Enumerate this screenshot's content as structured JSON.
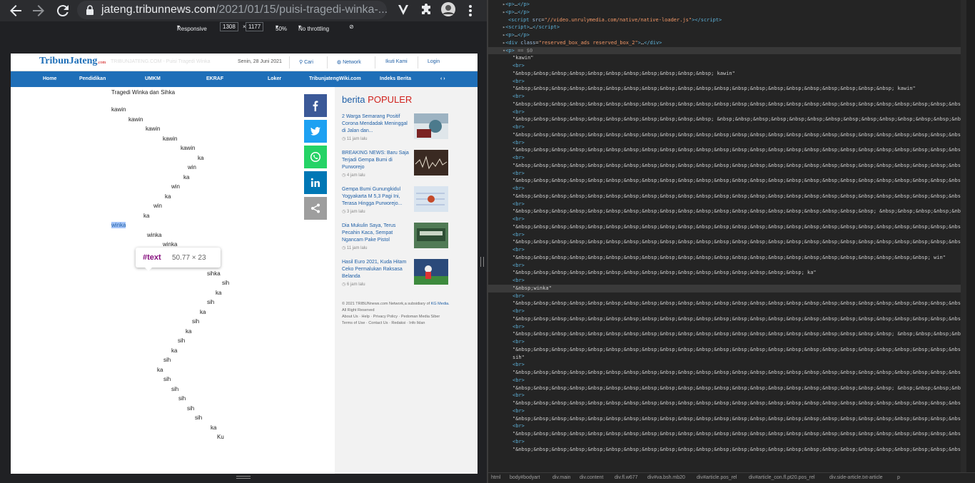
{
  "browser": {
    "url_domain": "jateng.tribunnews.com",
    "url_path": "/2021/01/15/puisi-tragedi-winka-...",
    "back_icon": "arrow-left-icon",
    "forward_icon": "arrow-right-icon",
    "reload_icon": "reload-icon",
    "menu_icon": "vertical-dots-icon"
  },
  "device_toolbar": {
    "mode": "Responsive",
    "width": "1308",
    "times": "×",
    "height": "1177",
    "zoom": "50%",
    "throttle": "No throttling"
  },
  "site": {
    "logo": "TribunJateng",
    "logo_sub": ".com",
    "ghost_text": "TRIBUNJATENG.COM - Puisi Tragedi Winka",
    "date": "Senin, 28 Juni 2021",
    "search": "Cari",
    "network": "Network",
    "follow": "Ikuti Kami",
    "login": "Login",
    "menu": [
      "Home",
      "Pendidikan",
      "UMKM",
      "EKRAF",
      "Loker",
      "TribunjatengWiki.com",
      "Indeks Berita"
    ],
    "menu_arrows": "‹ ›"
  },
  "poem": {
    "title": "Tragedi Winka dan Sihka",
    "lines": [
      "kawin",
      "kawin",
      "kawin",
      "kawin",
      "kawin",
      "ka",
      "win",
      "ka",
      "win",
      "ka",
      "win",
      "ka",
      "winka",
      "winka",
      "winka",
      "sihka",
      "sihka",
      "sihka",
      "sih",
      "ka",
      "sih",
      "ka",
      "sih",
      "ka",
      "sih",
      "ka",
      "sih",
      "ka",
      "sih",
      "sih",
      "sih",
      "sih",
      "sih",
      "ka",
      "Ku"
    ]
  },
  "inspect_tooltip": {
    "node": "#text",
    "size": "50.77 × 23"
  },
  "popular": {
    "title_a": "berita",
    "title_b": "POPULER",
    "items": [
      {
        "title": "2 Warga Semarang Positif Corona Mendadak Meninggal di Jalan dan...",
        "time": "11 jam lalu"
      },
      {
        "title": "BREAKING NEWS: Baru Saja Terjadi Gempa Bumi di Purworejo",
        "time": "4 jam lalu"
      },
      {
        "title": "Gempa Bumi Gunungkidul Yogyakarta M 5,3 Pagi Ini, Terasa Hingga Purworejo...",
        "time": "3 jam lalu"
      },
      {
        "title": "Dia Mukulin Saya, Terus Pecahin Kaca, Sempat Ngancam Pake Pistol",
        "time": "11 jam lalu"
      },
      {
        "title": "Hasil Euro 2021, Kuda Hitam Ceko Permalukan Raksasa Belanda",
        "time": "6 jam lalu"
      }
    ],
    "footer_line1": "© 2021 TRIBUNnews.com Network,a subsidiary of",
    "footer_kg": "KG Media.",
    "footer_line2": "All Right Reserved",
    "footer_links": [
      "About Us",
      "Help",
      "Privacy Policy",
      "Pedoman Media Siber",
      "Terms of Use",
      "Contact Us",
      "Redaksi",
      "Info Iklan"
    ]
  },
  "devtools": {
    "dom_lines": [
      {
        "indent": 20,
        "html": "<span class='gray'>▸</span><span class='tag'>&lt;p&gt;</span>…<span class='tag'>&lt;/p&gt;</span>"
      },
      {
        "indent": 20,
        "html": "<span class='gray'>▸</span><span class='tag'>&lt;p&gt;</span>…<span class='tag'>&lt;/p&gt;</span>"
      },
      {
        "indent": 28,
        "html": "<span class='tag'>&lt;script </span><span class='attr'>src</span>=<span class='val'>\"//video.unrulymedia.com/native/native-loader.js\"</span><span class='tag'>&gt;&lt;/script&gt;</span>"
      },
      {
        "indent": 20,
        "html": "<span class='gray'>▸</span><span class='tag'>&lt;script&gt;</span>…<span class='tag'>&lt;/script&gt;</span>"
      },
      {
        "indent": 20,
        "html": "<span class='gray'>▸</span><span class='tag'>&lt;p&gt;</span>…<span class='tag'>&lt;/p&gt;</span>"
      },
      {
        "indent": 20,
        "html": "<span class='gray'>▸</span><span class='tag'>&lt;div </span><span class='attr'>class</span>=<span class='val'>\"reserved_box_ads reserved_box_2\"</span><span class='tag'>&gt;</span>…<span class='tag'>&lt;/div&gt;</span>"
      },
      {
        "indent": 20,
        "html": "<span class='gray'>▾</span><span class='tag'>&lt;p&gt;</span> <span class='gray'>== $0</span>",
        "cls": "hl"
      },
      {
        "indent": 34,
        "html": "<span class='txt'>\"kawin\"</span>"
      },
      {
        "indent": 34,
        "html": "<span class='tag'>&lt;br&gt;</span>"
      },
      {
        "indent": 34,
        "html": "<span class='txt'>\"&amp;nbsp;&amp;nbsp;&amp;nbsp;&amp;nbsp;&amp;nbsp;&amp;nbsp;&amp;nbsp;&amp;nbsp;&amp;nbsp;&amp;nbsp;&amp;nbsp; kawin\"</span>"
      },
      {
        "indent": 34,
        "html": "<span class='tag'>&lt;br&gt;</span>"
      },
      {
        "indent": 34,
        "html": "<span class='txt'>\"&amp;nbsp;&amp;nbsp;&amp;nbsp;&amp;nbsp;&amp;nbsp;&amp;nbsp;&amp;nbsp;&amp;nbsp;&amp;nbsp;&amp;nbsp;&amp;nbsp;&amp;nbsp;&amp;nbsp;&amp;nbsp;&amp;nbsp;&amp;nbsp;&amp;nbsp;&amp;nbsp;&amp;nbsp;&amp;nbsp;&amp;nbsp; kawin\"</span>"
      },
      {
        "indent": 34,
        "html": "<span class='tag'>&lt;br&gt;</span>"
      },
      {
        "indent": 34,
        "html": "<span class='txt'>\"&amp;nbsp;&amp;nbsp;&amp;nbsp;&amp;nbsp;&amp;nbsp;&amp;nbsp;&amp;nbsp;&amp;nbsp;&amp;nbsp;&amp;nbsp;&amp;nbsp;&amp;nbsp;&amp;nbsp;&amp;nbsp;&amp;nbsp;&amp;nbsp;&amp;nbsp;&amp;nbsp;&amp;nbsp;&amp;nbsp;&amp;nbsp;&amp;nbsp;&amp;nbsp;&amp;nbsp;&amp;nbsp;&amp;nbsp;&amp;nbsp;&amp;nbsp;&amp;nbsp;&amp;nbsp;&amp;nbsp;&amp;nbsp;&amp;nbsp;&amp;nbsp;&amp;nbsp;\"</span>"
      },
      {
        "indent": 34,
        "html": "<span class='tag'>&lt;br&gt;</span>"
      },
      {
        "indent": 34,
        "html": "<span class='txt'>\"&amp;nbsp;&amp;nbsp;&amp;nbsp;&amp;nbsp;&amp;nbsp;&amp;nbsp;&amp;nbsp;&amp;nbsp;&amp;nbsp;&amp;nbsp;&amp;nbsp; &amp;nbsp;&amp;nbsp;&amp;nbsp;&amp;nbsp;&amp;nbsp;&amp;nbsp;&amp;nbsp;&amp;nbsp;&amp;nbsp;&amp;nbsp;&amp;nbsp;&amp;nbsp;&amp;nbsp;&amp;nbsp;&amp;nbsp;&amp;nbsp;&amp;nbsp;&amp;nbsp;&amp;nbsp;&amp;nbsp;&amp;nbsp;&amp;nbsp;&amp;nbsp;\"</span>"
      },
      {
        "indent": 34,
        "html": "<span class='tag'>&lt;br&gt;</span>"
      },
      {
        "indent": 34,
        "html": "<span class='txt'>\"&amp;nbsp;&amp;nbsp;&amp;nbsp;&amp;nbsp;&amp;nbsp;&amp;nbsp;&amp;nbsp;&amp;nbsp;&amp;nbsp;&amp;nbsp;&amp;nbsp;&amp;nbsp;&amp;nbsp;&amp;nbsp;&amp;nbsp;&amp;nbsp;&amp;nbsp;&amp;nbsp;&amp;nbsp;&amp;nbsp;&amp;nbsp;&amp;nbsp;&amp;nbsp;&amp;nbsp;&amp;nbsp;&amp;nbsp;&amp;nbsp;&amp;nbsp;&amp;nbsp;&amp;nbsp;&amp;nbsp;&amp;nbsp;&amp;nbsp;&amp;nbsp;&amp;nbsp;\"</span>"
      },
      {
        "indent": 34,
        "html": "<span class='tag'>&lt;br&gt;</span>"
      },
      {
        "indent": 34,
        "html": "<span class='txt'>\"&amp;nbsp;&amp;nbsp;&amp;nbsp;&amp;nbsp;&amp;nbsp;&amp;nbsp;&amp;nbsp;&amp;nbsp;&amp;nbsp;&amp;nbsp;&amp;nbsp;&amp;nbsp;&amp;nbsp;&amp;nbsp;&amp;nbsp;&amp;nbsp;&amp;nbsp;&amp;nbsp;&amp;nbsp;&amp;nbsp;&amp;nbsp;&amp;nbsp;&amp;nbsp;&amp;nbsp;&amp;nbsp;&amp;nbsp;&amp;nbsp;&amp;nbsp;&amp;nbsp;&amp;nbsp;&amp;nbsp;&amp;nbsp;&amp;nbsp;&amp;nbsp;&amp;nbsp;\"</span>"
      },
      {
        "indent": 34,
        "html": "<span class='tag'>&lt;br&gt;</span>"
      },
      {
        "indent": 34,
        "html": "<span class='txt'>\"&amp;nbsp;&amp;nbsp;&amp;nbsp;&amp;nbsp;&amp;nbsp;&amp;nbsp;&amp;nbsp;&amp;nbsp;&amp;nbsp;&amp;nbsp;&amp;nbsp;&amp;nbsp;&amp;nbsp;&amp;nbsp;&amp;nbsp;&amp;nbsp;&amp;nbsp;&amp;nbsp;&amp;nbsp;&amp;nbsp;&amp;nbsp;&amp;nbsp;&amp;nbsp;&amp;nbsp;&amp;nbsp;&amp;nbsp;&amp;nbsp;&amp;nbsp;&amp;nbsp;&amp;nbsp;&amp;nbsp;&amp;nbsp;&amp;nbsp;&amp;nbsp;&amp;nbsp;\"</span>"
      },
      {
        "indent": 34,
        "html": "<span class='tag'>&lt;br&gt;</span>"
      },
      {
        "indent": 34,
        "html": "<span class='txt'>\"&amp;nbsp;&amp;nbsp;&amp;nbsp;&amp;nbsp;&amp;nbsp;&amp;nbsp;&amp;nbsp;&amp;nbsp;&amp;nbsp;&amp;nbsp;&amp;nbsp;&amp;nbsp;&amp;nbsp;&amp;nbsp;&amp;nbsp;&amp;nbsp;&amp;nbsp;&amp;nbsp;&amp;nbsp;&amp;nbsp;&amp;nbsp;&amp;nbsp;&amp;nbsp;&amp;nbsp;&amp;nbsp;&amp;nbsp;&amp;nbsp;&amp;nbsp;&amp;nbsp;&amp;nbsp;&amp;nbsp;&amp;nbsp;&amp;nbsp;&amp;nbsp;&amp;nbsp;\"</span>"
      },
      {
        "indent": 34,
        "html": "<span class='tag'>&lt;br&gt;</span>"
      },
      {
        "indent": 34,
        "html": "<span class='txt'>\"&amp;nbsp;&amp;nbsp;&amp;nbsp;&amp;nbsp;&amp;nbsp;&amp;nbsp;&amp;nbsp;&amp;nbsp;&amp;nbsp;&amp;nbsp;&amp;nbsp;&amp;nbsp;&amp;nbsp;&amp;nbsp;&amp;nbsp;&amp;nbsp;&amp;nbsp;&amp;nbsp;&amp;nbsp;&amp;nbsp;&amp;nbsp;&amp;nbsp;&amp;nbsp;&amp;nbsp;&amp;nbsp;&amp;nbsp;&amp;nbsp;&amp;nbsp;&amp;nbsp;&amp;nbsp;&amp;nbsp;&amp;nbsp;&amp;nbsp;&amp;nbsp;&amp;nbsp;\"</span>"
      },
      {
        "indent": 34,
        "html": "<span class='tag'>&lt;br&gt;</span>"
      },
      {
        "indent": 34,
        "html": "<span class='txt'>\"&amp;nbsp;&amp;nbsp;&amp;nbsp;&amp;nbsp;&amp;nbsp;&amp;nbsp;&amp;nbsp;&amp;nbsp;&amp;nbsp;&amp;nbsp;&amp;nbsp;&amp;nbsp;&amp;nbsp;&amp;nbsp;&amp;nbsp;&amp;nbsp;&amp;nbsp;&amp;nbsp;&amp;nbsp;&amp;nbsp; &amp;nbsp;&amp;nbsp;&amp;nbsp;&amp;nbsp;&amp;nbsp;&amp;nbsp;&amp;nbsp;&amp;nbsp;&amp;nbsp;&amp;nbsp;&amp;nbsp;&amp;nbsp;&amp;nbsp;&amp;nbsp;\"</span>"
      },
      {
        "indent": 34,
        "html": "<span class='tag'>&lt;br&gt;</span>"
      },
      {
        "indent": 34,
        "html": "<span class='txt'>\"&amp;nbsp;&amp;nbsp;&amp;nbsp;&amp;nbsp;&amp;nbsp;&amp;nbsp;&amp;nbsp;&amp;nbsp;&amp;nbsp;&amp;nbsp;&amp;nbsp;&amp;nbsp;&amp;nbsp;&amp;nbsp;&amp;nbsp;&amp;nbsp;&amp;nbsp;&amp;nbsp;&amp;nbsp;&amp;nbsp;&amp;nbsp;&amp;nbsp;&amp;nbsp;&amp;nbsp;&amp;nbsp;&amp;nbsp;&amp;nbsp;&amp;nbsp;&amp;nbsp;&amp;nbsp;&amp;nbsp;&amp;nbsp;&amp;nbsp;&amp;nbsp;&amp;nbsp;\"</span>"
      },
      {
        "indent": 34,
        "html": "<span class='tag'>&lt;br&gt;</span>"
      },
      {
        "indent": 34,
        "html": "<span class='txt'>\"&amp;nbsp;&amp;nbsp;&amp;nbsp;&amp;nbsp;&amp;nbsp;&amp;nbsp;&amp;nbsp;&amp;nbsp;&amp;nbsp;&amp;nbsp;&amp;nbsp;&amp;nbsp;&amp;nbsp;&amp;nbsp;&amp;nbsp;&amp;nbsp;&amp;nbsp;&amp;nbsp;&amp;nbsp;&amp;nbsp;&amp;nbsp;&amp;nbsp;&amp;nbsp;&amp;nbsp;&amp;nbsp;&amp;nbsp; ka\"</span>"
      },
      {
        "indent": 34,
        "html": "<span class='tag'>&lt;br&gt;</span>"
      },
      {
        "indent": 34,
        "html": "<span class='txt'>\"&amp;nbsp;&amp;nbsp;&amp;nbsp;&amp;nbsp;&amp;nbsp;&amp;nbsp;&amp;nbsp;&amp;nbsp;&amp;nbsp;&amp;nbsp;&amp;nbsp;&amp;nbsp;&amp;nbsp;&amp;nbsp;&amp;nbsp;&amp;nbsp;&amp;nbsp;&amp;nbsp;&amp;nbsp;&amp;nbsp;&amp;nbsp;&amp;nbsp;&amp;nbsp; win\"</span>"
      },
      {
        "indent": 34,
        "html": "<span class='tag'>&lt;br&gt;</span>"
      },
      {
        "indent": 34,
        "html": "<span class='txt'>\"&amp;nbsp;&amp;nbsp;&amp;nbsp;&amp;nbsp;&amp;nbsp;&amp;nbsp;&amp;nbsp;&amp;nbsp;&amp;nbsp;&amp;nbsp;&amp;nbsp;&amp;nbsp;&amp;nbsp;&amp;nbsp;&amp;nbsp;&amp;nbsp; ka\"</span>"
      },
      {
        "indent": 34,
        "html": "<span class='tag'>&lt;br&gt;</span>"
      },
      {
        "indent": 34,
        "html": "<span class='txt'>\"&amp;nbsp;winka\"</span>",
        "cls": "sel2"
      },
      {
        "indent": 34,
        "html": "<span class='tag'>&lt;br&gt;</span>"
      },
      {
        "indent": 34,
        "html": "<span class='txt'>\"&amp;nbsp;&amp;nbsp;&amp;nbsp;&amp;nbsp;&amp;nbsp;&amp;nbsp;&amp;nbsp;&amp;nbsp;&amp;nbsp;&amp;nbsp;&amp;nbsp;&amp;nbsp;&amp;nbsp;&amp;nbsp;&amp;nbsp;&amp;nbsp;&amp;nbsp;&amp;nbsp;&amp;nbsp;&amp;nbsp;&amp;nbsp;&amp;nbsp;&amp;nbsp;&amp;nbsp;&amp;nbsp;&amp;nbsp;&amp;nbsp; winka\"</span>"
      },
      {
        "indent": 34,
        "html": "<span class='tag'>&lt;br&gt;</span>"
      },
      {
        "indent": 34,
        "html": "<span class='txt'>\"&amp;nbsp;&amp;nbsp;&amp;nbsp;&amp;nbsp;&amp;nbsp;&amp;nbsp;&amp;nbsp;&amp;nbsp;&amp;nbsp;&amp;nbsp;&amp;nbsp;&amp;nbsp;&amp;nbsp;&amp;nbsp;&amp;nbsp;&amp;nbsp;&amp;nbsp;&amp;nbsp;&amp;nbsp;&amp;nbsp;&amp;nbsp;&amp;nbsp;&amp;nbsp;&amp;nbsp;&amp;nbsp;&amp;nbsp;&amp;nbsp;&amp;nbsp;&amp;nbsp;&amp;nbsp;&amp;nbsp;&amp;nbsp;&amp;nbsp;&amp;nbsp;&amp;nbsp;\"</span>"
      },
      {
        "indent": 34,
        "html": "<span class='tag'>&lt;br&gt;</span>"
      },
      {
        "indent": 34,
        "html": "<span class='txt'>\"&amp;nbsp;&amp;nbsp;&amp;nbsp;&amp;nbsp;&amp;nbsp;&amp;nbsp;&amp;nbsp;&amp;nbsp;&amp;nbsp;&amp;nbsp;&amp;nbsp;&amp;nbsp;&amp;nbsp;&amp;nbsp;&amp;nbsp;&amp;nbsp;&amp;nbsp;&amp;nbsp;&amp;nbsp;&amp;nbsp;&amp;nbsp; &amp;nbsp;&amp;nbsp;&amp;nbsp;&amp;nbsp;&amp;nbsp;&amp;nbsp;&amp;nbsp;&amp;nbsp;&amp;nbsp;&amp;nbsp;&amp;nbsp;&amp;nbsp;&amp;nbsp;\"</span>"
      },
      {
        "indent": 34,
        "html": "<span class='tag'>&lt;br&gt;</span>"
      },
      {
        "indent": 34,
        "html": "<span class='txt'>\"&amp;nbsp;&amp;nbsp;&amp;nbsp;&amp;nbsp;&amp;nbsp;&amp;nbsp;&amp;nbsp;&amp;nbsp;&amp;nbsp;&amp;nbsp;&amp;nbsp;&amp;nbsp;&amp;nbsp;&amp;nbsp;&amp;nbsp;&amp;nbsp;&amp;nbsp;&amp;nbsp;&amp;nbsp;&amp;nbsp;&amp;nbsp;&amp;nbsp;&amp;nbsp;&amp;nbsp;&amp;nbsp;&amp;nbsp;&amp;nbsp;&amp;nbsp;&amp;nbsp;&amp;nbsp;&amp;nbsp;&amp;nbsp;&amp;nbsp;&amp;nbsp;&amp;nbsp;\"</span>"
      },
      {
        "indent": 34,
        "html": "<span class='txt'>sih\"</span>"
      },
      {
        "indent": 34,
        "html": "<span class='tag'>&lt;br&gt;</span>"
      },
      {
        "indent": 34,
        "html": "<span class='txt'>\"&amp;nbsp;&amp;nbsp;&amp;nbsp;&amp;nbsp;&amp;nbsp;&amp;nbsp;&amp;nbsp;&amp;nbsp;&amp;nbsp;&amp;nbsp;&amp;nbsp;&amp;nbsp;&amp;nbsp;&amp;nbsp;&amp;nbsp;&amp;nbsp;&amp;nbsp;&amp;nbsp;&amp;nbsp;&amp;nbsp;&amp;nbsp;&amp;nbsp;&amp;nbsp;&amp;nbsp;&amp;nbsp;&amp;nbsp;&amp;nbsp;&amp;nbsp;&amp;nbsp;&amp;nbsp;&amp;nbsp;&amp;nbsp;&amp;nbsp;&amp;nbsp;&amp;nbsp;\"</span>"
      },
      {
        "indent": 34,
        "html": "<span class='tag'>&lt;br&gt;</span>"
      },
      {
        "indent": 34,
        "html": "<span class='txt'>\"&amp;nbsp;&amp;nbsp;&amp;nbsp;&amp;nbsp;&amp;nbsp;&amp;nbsp;&amp;nbsp;&amp;nbsp;&amp;nbsp;&amp;nbsp;&amp;nbsp;&amp;nbsp;&amp;nbsp;&amp;nbsp;&amp;nbsp;&amp;nbsp;&amp;nbsp;&amp;nbsp;&amp;nbsp;&amp;nbsp;&amp;nbsp; &amp;nbsp;&amp;nbsp;&amp;nbsp;&amp;nbsp;&amp;nbsp;&amp;nbsp;&amp;nbsp;&amp;nbsp;&amp;nbsp;&amp;nbsp;&amp;nbsp;&amp;nbsp;&amp;nbsp;\"</span>"
      },
      {
        "indent": 34,
        "html": "<span class='tag'>&lt;br&gt;</span>"
      },
      {
        "indent": 34,
        "html": "<span class='txt'>\"&amp;nbsp;&amp;nbsp;&amp;nbsp;&amp;nbsp;&amp;nbsp;&amp;nbsp;&amp;nbsp;&amp;nbsp;&amp;nbsp;&amp;nbsp;&amp;nbsp;&amp;nbsp;&amp;nbsp;&amp;nbsp;&amp;nbsp;&amp;nbsp;&amp;nbsp;&amp;nbsp;&amp;nbsp;&amp;nbsp;&amp;nbsp;&amp;nbsp;&amp;nbsp;&amp;nbsp;&amp;nbsp;&amp;nbsp;&amp;nbsp;&amp;nbsp;&amp;nbsp;&amp;nbsp;&amp;nbsp;&amp;nbsp;&amp;nbsp;&amp;nbsp;&amp;nbsp;\"</span>"
      },
      {
        "indent": 34,
        "html": "<span class='tag'>&lt;br&gt;</span>"
      },
      {
        "indent": 34,
        "html": "<span class='txt'>\"&amp;nbsp;&amp;nbsp;&amp;nbsp;&amp;nbsp;&amp;nbsp;&amp;nbsp;&amp;nbsp;&amp;nbsp;&amp;nbsp;&amp;nbsp;&amp;nbsp;&amp;nbsp;&amp;nbsp;&amp;nbsp;&amp;nbsp;&amp;nbsp;&amp;nbsp;&amp;nbsp;&amp;nbsp;&amp;nbsp;&amp;nbsp;&amp;nbsp;&amp;nbsp;&amp;nbsp;&amp;nbsp;&amp;nbsp;&amp;nbsp;&amp;nbsp;&amp;nbsp;&amp;nbsp;&amp;nbsp;&amp;nbsp;&amp;nbsp;&amp;nbsp;&amp;nbsp;\"</span>"
      },
      {
        "indent": 34,
        "html": "<span class='tag'>&lt;br&gt;</span>"
      },
      {
        "indent": 34,
        "html": "<span class='txt'>\"&amp;nbsp;&amp;nbsp;&amp;nbsp;&amp;nbsp;&amp;nbsp;&amp;nbsp;&amp;nbsp;&amp;nbsp;&amp;nbsp;&amp;nbsp;&amp;nbsp;&amp;nbsp;&amp;nbsp;&amp;nbsp;&amp;nbsp;&amp;nbsp;&amp;nbsp;&amp;nbsp;&amp;nbsp;&amp;nbsp;&amp;nbsp;&amp;nbsp;&amp;nbsp;&amp;nbsp;&amp;nbsp;&amp;nbsp;&amp;nbsp;&amp;nbsp;&amp;nbsp;&amp;nbsp;&amp;nbsp;&amp;nbsp;&amp;nbsp;&amp;nbsp;&amp;nbsp;\"</span>"
      },
      {
        "indent": 34,
        "html": "<span class='tag'>&lt;br&gt;</span>"
      },
      {
        "indent": 34,
        "html": "<span class='txt'>\"&amp;nbsp;&amp;nbsp;&amp;nbsp;&amp;nbsp;&amp;nbsp;&amp;nbsp;&amp;nbsp;&amp;nbsp;&amp;nbsp;&amp;nbsp;&amp;nbsp;&amp;nbsp;&amp;nbsp;&amp;nbsp;&amp;nbsp;&amp;nbsp;&amp;nbsp;&amp;nbsp;&amp;nbsp;&amp;nbsp;&amp;nbsp;&amp;nbsp;&amp;nbsp;&amp;nbsp;&amp;nbsp;&amp;nbsp;&amp;nbsp;&amp;nbsp;&amp;nbsp;&amp;nbsp;&amp;nbsp;&amp;nbsp;&amp;nbsp;&amp;nbsp;&amp;nbsp;\"</span>"
      }
    ],
    "breadcrumbs": [
      "html",
      "body#bodyart",
      "div.main",
      "div.content",
      "div.fl.w677",
      "div#va.bsh.mb20",
      "div#article.pos_rel",
      "div#article_con.fl.pt20.pos_rel",
      "div.side-article.txt-article",
      "p"
    ]
  },
  "colors": {
    "accent": "#1f6fb8",
    "facebook": "#3b5998",
    "twitter": "#1da1f2",
    "whatsapp": "#25d366",
    "linkedin": "#0077b5",
    "share": "#9e9e9e"
  }
}
